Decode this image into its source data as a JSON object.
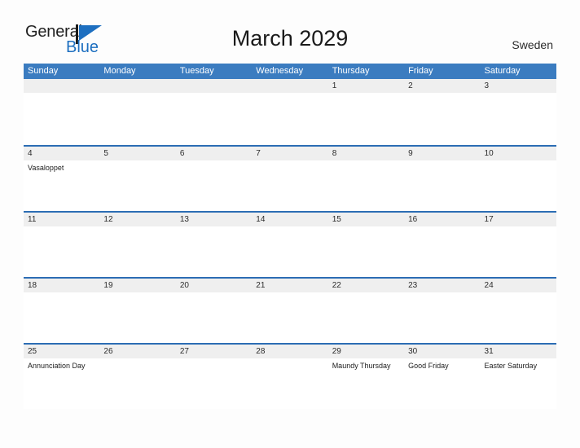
{
  "brand": {
    "word_one": "General",
    "word_two": "Blue",
    "flag_icon": "brand-flag-icon",
    "accent_color": "#1d6fc0"
  },
  "header": {
    "title": "March 2029",
    "region": "Sweden"
  },
  "colors": {
    "header_bar": "#3b7cc0",
    "week_rule": "#2c6db4",
    "date_band": "#efefef",
    "page_background": "#fdfdfd"
  },
  "calendar": {
    "weekday_headers": [
      "Sunday",
      "Monday",
      "Tuesday",
      "Wednesday",
      "Thursday",
      "Friday",
      "Saturday"
    ],
    "weeks": [
      {
        "days": [
          {
            "number": "",
            "events": []
          },
          {
            "number": "",
            "events": []
          },
          {
            "number": "",
            "events": []
          },
          {
            "number": "",
            "events": []
          },
          {
            "number": "1",
            "events": []
          },
          {
            "number": "2",
            "events": []
          },
          {
            "number": "3",
            "events": []
          }
        ]
      },
      {
        "days": [
          {
            "number": "4",
            "events": [
              "Vasaloppet"
            ]
          },
          {
            "number": "5",
            "events": []
          },
          {
            "number": "6",
            "events": []
          },
          {
            "number": "7",
            "events": []
          },
          {
            "number": "8",
            "events": []
          },
          {
            "number": "9",
            "events": []
          },
          {
            "number": "10",
            "events": []
          }
        ]
      },
      {
        "days": [
          {
            "number": "11",
            "events": []
          },
          {
            "number": "12",
            "events": []
          },
          {
            "number": "13",
            "events": []
          },
          {
            "number": "14",
            "events": []
          },
          {
            "number": "15",
            "events": []
          },
          {
            "number": "16",
            "events": []
          },
          {
            "number": "17",
            "events": []
          }
        ]
      },
      {
        "days": [
          {
            "number": "18",
            "events": []
          },
          {
            "number": "19",
            "events": []
          },
          {
            "number": "20",
            "events": []
          },
          {
            "number": "21",
            "events": []
          },
          {
            "number": "22",
            "events": []
          },
          {
            "number": "23",
            "events": []
          },
          {
            "number": "24",
            "events": []
          }
        ]
      },
      {
        "days": [
          {
            "number": "25",
            "events": [
              "Annunciation Day"
            ]
          },
          {
            "number": "26",
            "events": []
          },
          {
            "number": "27",
            "events": []
          },
          {
            "number": "28",
            "events": []
          },
          {
            "number": "29",
            "events": [
              "Maundy Thursday"
            ]
          },
          {
            "number": "30",
            "events": [
              "Good Friday"
            ]
          },
          {
            "number": "31",
            "events": [
              "Easter Saturday"
            ]
          }
        ]
      }
    ]
  }
}
